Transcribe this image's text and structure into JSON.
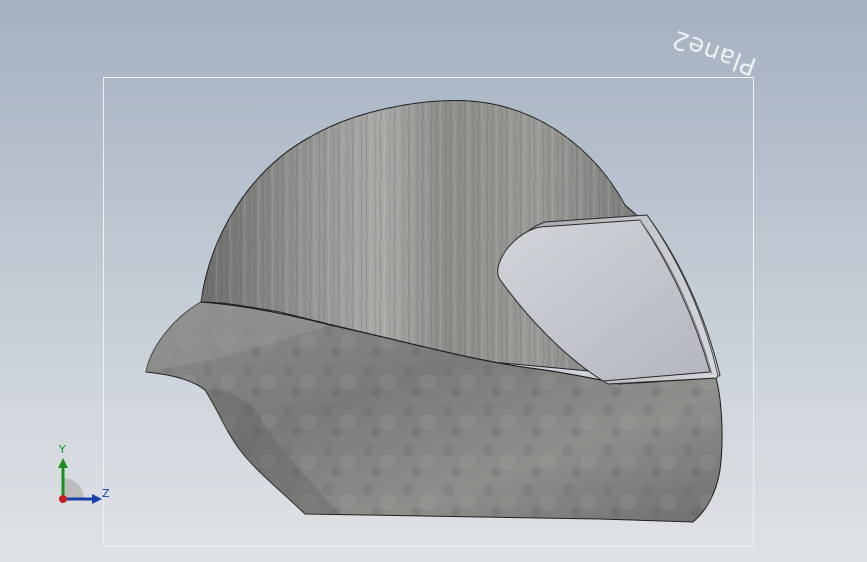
{
  "viewport": {
    "plane_label": "Plane2",
    "background_top": "#a5b1c0",
    "background_bottom": "#dfe2e6"
  },
  "model": {
    "name": "helmet",
    "shell_color": "#8a8a88",
    "visor_color": "#c4c7cc"
  },
  "triad": {
    "y_label": "Y",
    "z_label": "Z",
    "y_color": "#1b8f1b",
    "z_color": "#1c3fae",
    "origin_color": "#c81e1e"
  }
}
